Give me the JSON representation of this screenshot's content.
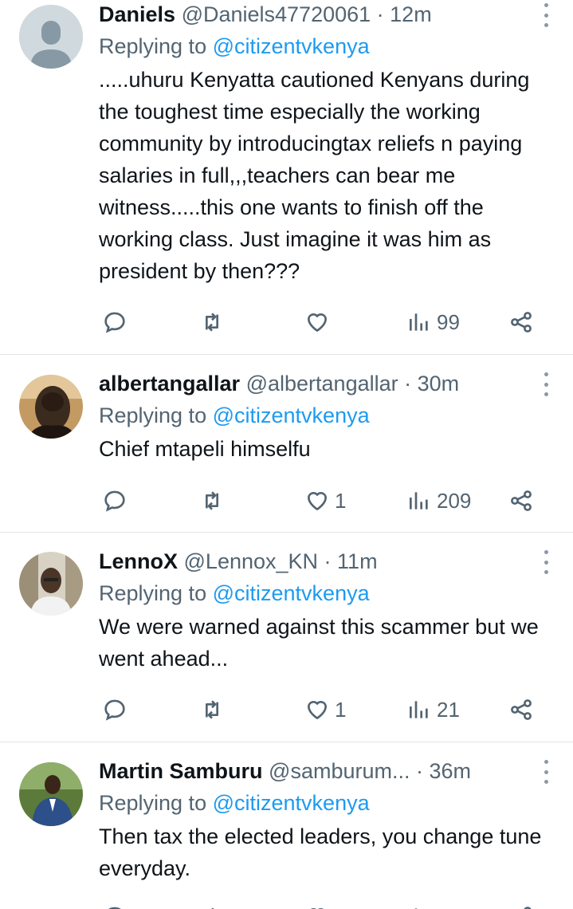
{
  "colors": {
    "link": "#1d9bf0",
    "muted": "#536471",
    "text": "#0f1419",
    "divider": "#e1e4e7"
  },
  "tweets": [
    {
      "name": "Daniels",
      "handle": "@Daniels47720061",
      "time": "· 12m",
      "reply_prefix": "Replying to",
      "reply_to": "@citizentvkenya",
      "text": ".....uhuru Kenyatta cautioned Kenyans during the toughest time especially the working community by introducingtax reliefs n paying salaries in full,,,teachers can bear me witness.....this one wants to finish off the working class. Just imagine it was him as president by then???",
      "likes": "",
      "views": "99",
      "avatar": "default-avatar-icon"
    },
    {
      "name": "albertangallar",
      "handle": "@albertangallar",
      "time": "· 30m",
      "reply_prefix": "Replying to",
      "reply_to": "@citizentvkenya",
      "text": "Chief mtapeli himselfu",
      "likes": "1",
      "views": "209",
      "avatar": "photo"
    },
    {
      "name": "LennoX",
      "handle": "@Lennox_KN",
      "time": "· 11m",
      "reply_prefix": "Replying to",
      "reply_to": "@citizentvkenya",
      "text": "We were warned against this scammer but we went ahead...",
      "likes": "1",
      "views": "21",
      "avatar": "photo"
    },
    {
      "name": "Martin Samburu",
      "handle": "@samburum...",
      "time": "· 36m",
      "reply_prefix": "Replying to",
      "reply_to": "@citizentvkenya",
      "text": "Then tax the elected leaders, you change tune everyday.",
      "likes": "",
      "views": "",
      "avatar": "photo"
    }
  ]
}
